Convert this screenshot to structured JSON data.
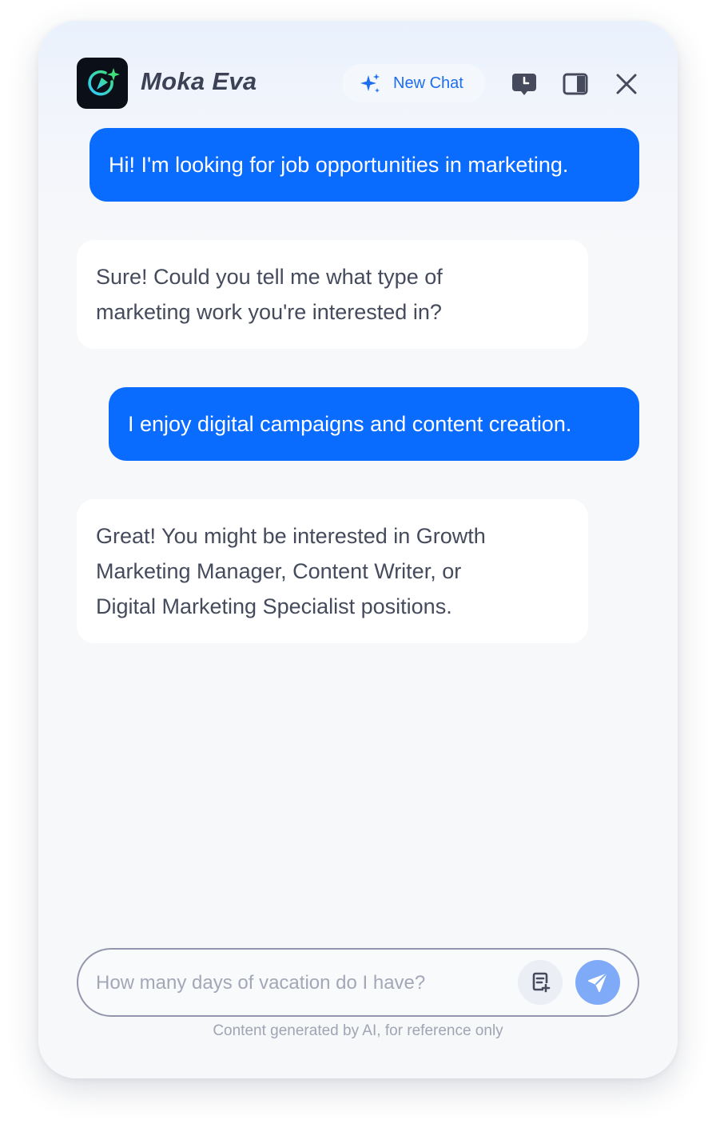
{
  "header": {
    "app_name": "Moka Eva",
    "logo_icon": "moka-eva-logo-icon",
    "new_chat_label": "New Chat",
    "new_chat_icon": "sparkle-icon",
    "actions": [
      "history-icon",
      "sidebar-toggle-icon",
      "close-icon"
    ]
  },
  "messages": [
    {
      "role": "user",
      "lines": [
        "Hi! I'm looking for job opportunities in marketing."
      ]
    },
    {
      "role": "assistant",
      "lines": [
        "Sure! Could you tell me what type of",
        "marketing work you're interested in?"
      ]
    },
    {
      "role": "user",
      "lines": [
        "I enjoy digital campaigns and content creation."
      ]
    },
    {
      "role": "assistant",
      "lines": [
        "Great! You might be interested in Growth",
        "Marketing Manager, Content Writer, or",
        "Digital Marketing Specialist positions."
      ]
    }
  ],
  "composer": {
    "placeholder": "How many days of vacation do I have?",
    "attach_icon": "document-add-icon",
    "send_icon": "send-icon"
  },
  "disclaimer": "Content generated by AI, for reference only",
  "colors": {
    "user_bubble": "#0a6bff",
    "accent": "#1e6ef0",
    "send_button": "#7faaf7",
    "logo_green": "#3ee07a",
    "logo_cyan": "#33c9ff"
  }
}
